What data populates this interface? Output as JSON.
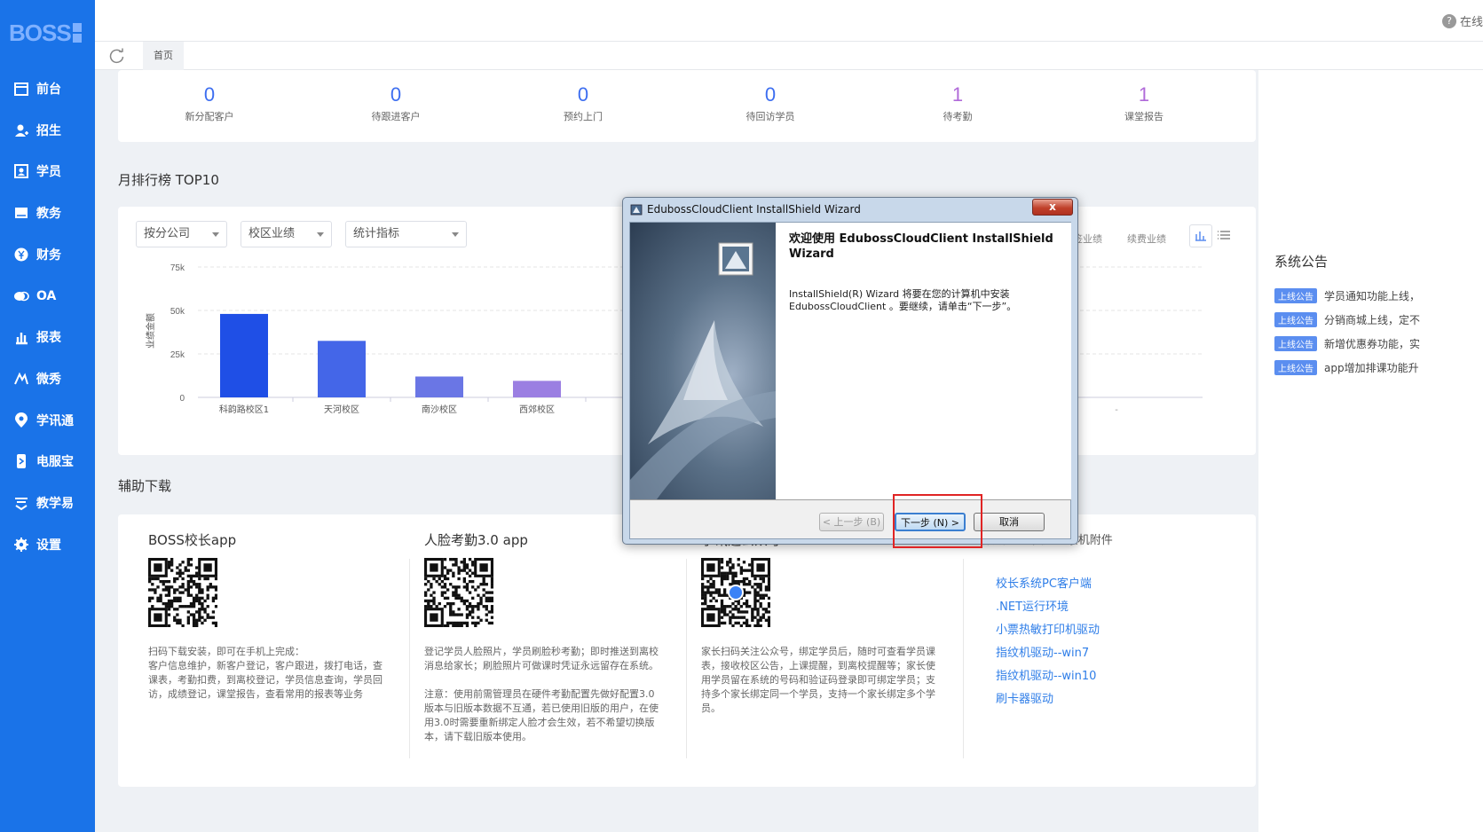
{
  "app": {
    "logo": "BOSS",
    "help_label": "在线"
  },
  "sidebar": {
    "items": [
      {
        "label": "前台",
        "icon": "calendar-icon"
      },
      {
        "label": "招生",
        "icon": "user-add-icon"
      },
      {
        "label": "学员",
        "icon": "id-card-icon"
      },
      {
        "label": "教务",
        "icon": "book-icon"
      },
      {
        "label": "财务",
        "icon": "yen-icon"
      },
      {
        "label": "OA",
        "icon": "chat-icon"
      },
      {
        "label": "报表",
        "icon": "bar-chart-icon"
      },
      {
        "label": "微秀",
        "icon": "sparkle-icon"
      },
      {
        "label": "学讯通",
        "icon": "location-icon"
      },
      {
        "label": "电服宝",
        "icon": "phone-icon"
      },
      {
        "label": "教学易",
        "icon": "teach-icon"
      },
      {
        "label": "设置",
        "icon": "gear-icon"
      }
    ]
  },
  "tabs": {
    "home": "首页"
  },
  "stats": [
    {
      "value": "0",
      "label": "新分配客户"
    },
    {
      "value": "0",
      "label": "待跟进客户"
    },
    {
      "value": "0",
      "label": "预约上门"
    },
    {
      "value": "0",
      "label": "待回访学员"
    },
    {
      "value": "1",
      "label": "待考勤"
    },
    {
      "value": "1",
      "label": "课堂报告"
    }
  ],
  "ranking": {
    "title": "月排行榜 TOP10",
    "filters": [
      "按分公司",
      "校区业绩",
      "统计指标"
    ],
    "toggles": [
      "新签业绩",
      "续费业绩"
    ]
  },
  "chart_data": {
    "type": "bar",
    "ylabel": "业绩金额",
    "yticks": [
      "75k",
      "50k",
      "25k",
      "0"
    ],
    "ylim": [
      0,
      75000
    ],
    "categories": [
      "科韵路校区1",
      "天河校区",
      "南沙校区",
      "西郊校区"
    ],
    "values": [
      48000,
      32500,
      12000,
      9500
    ],
    "extra_categories": [
      "-",
      "-"
    ],
    "grid": true
  },
  "downloads": {
    "title": "辅助下载",
    "columns": [
      {
        "title": "BOSS校长app",
        "desc": "扫码下载安装，即可在手机上完成：\n客户信息维护，新客户登记，客户跟进，拨打电话，查课表，考勤扣费，到离校登记，学员信息查询，学员回访，成绩登记，课堂报告，查看常用的报表等业务"
      },
      {
        "title": "人脸考勤3.0 app",
        "desc": "登记学员人脸照片，学员刷脸秒考勤；即时推送到离校消息给家长；刷脸照片可做课时凭证永远留存在系统。",
        "note": "注意：使用前需管理员在硬件考勤配置先做好配置3.0版本与旧版本数据不互通，若已使用旧版的用户，在使用3.0时需要重新绑定人脸才会生效，若不希望切换版本，请下载旧版本使用。"
      },
      {
        "title": "学讯通公众号",
        "desc": "家长扫码关注公众号，绑定学员后，随时可查看学员课表，接收校区公告，上课提醒，到离校提醒等；家长使用学员留在系统的号码和验证码登录即可绑定学员；支持多个家长绑定同一个学员，支持一个家长绑定多个学员。"
      },
      {
        "title": "指纹机/刷卡机/小票机附件",
        "links": [
          "校长系统PC客户端",
          ".NET运行环境",
          "小票热敏打印机驱动",
          "指纹机驱动--win7",
          "指纹机驱动--win10",
          "刷卡器驱动"
        ]
      }
    ]
  },
  "notices": {
    "title": "系统公告",
    "badge": "上线公告",
    "items": [
      "学员通知功能上线，",
      "分销商城上线，定不",
      "新增优惠券功能，实",
      "app增加排课功能升"
    ]
  },
  "dialog": {
    "title": "EdubossCloudClient InstallShield Wizard",
    "close": "x",
    "heading": "欢迎使用 EdubossCloudClient InstallShield Wizard",
    "body": "InstallShield(R) Wizard 将要在您的计算机中安装 EdubossCloudClient 。要继续，请单击“下一步”。",
    "back": "< 上一步 (B)",
    "next": "下一步 (N) >",
    "cancel": "取消"
  },
  "colors": {
    "sidebar": "#1a73e8",
    "bar_colors": [
      "#1f4fe6",
      "#4466e8",
      "#6a76e5",
      "#9b7fe2"
    ],
    "highlight": "#e02424"
  }
}
